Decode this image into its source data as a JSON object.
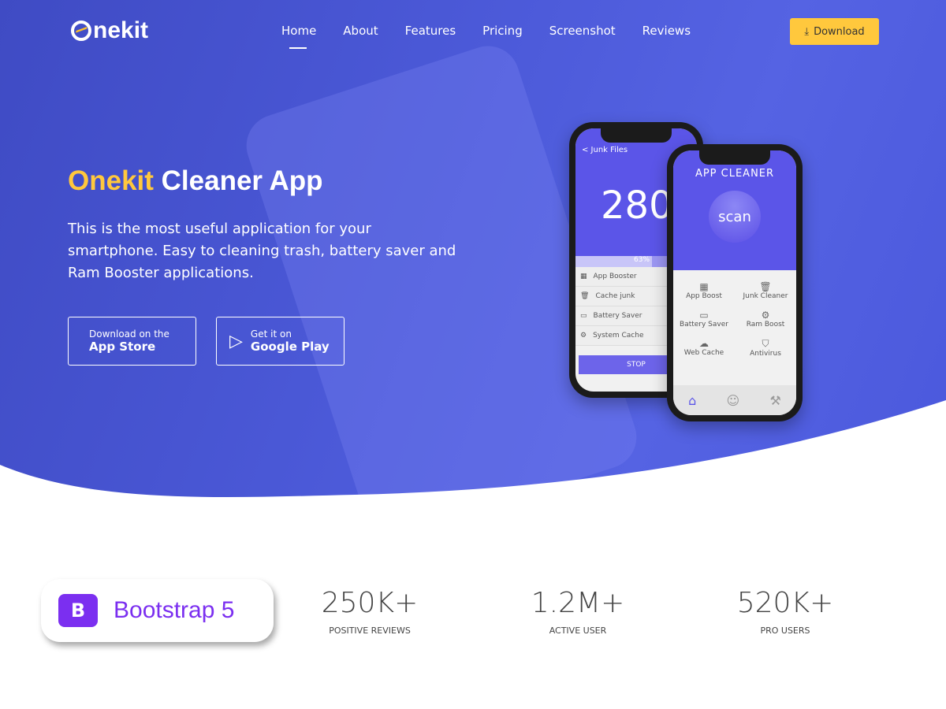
{
  "nav": {
    "logo": "nekit",
    "items": [
      "Home",
      "About",
      "Features",
      "Pricing",
      "Screenshot",
      "Reviews"
    ],
    "active": "Home",
    "download": "Download"
  },
  "hero": {
    "title_highlight": "Onekit",
    "title_rest": " Cleaner App",
    "description": "This is the most useful application for your smartphone. Easy to cleaning trash, battery saver and Ram Booster applications.",
    "appstore": {
      "small": "Download on the",
      "large": "App Store"
    },
    "googleplay": {
      "small": "Get it on",
      "large": "Google Play"
    }
  },
  "phone_back": {
    "header": "< Junk Files",
    "number": "280",
    "progress": "63%",
    "progress_value": 63,
    "items": [
      "App Booster",
      "Cache junk",
      "Battery Saver",
      "System Cache"
    ],
    "button": "STOP"
  },
  "phone_front": {
    "header": "APP CLEANER",
    "scan": "scan",
    "items": [
      "App Boost",
      "Junk Cleaner",
      "Battery Saver",
      "Ram Boost",
      "Web Cache",
      "Antivirus"
    ]
  },
  "badge": {
    "letter": "B",
    "text": "Bootstrap 5"
  },
  "stats": [
    {
      "value": "250K+",
      "label": "POSITIVE REVIEWS"
    },
    {
      "value": "1.2M+",
      "label": "ACTIVE USER"
    },
    {
      "value": "520K+",
      "label": "PRO USERS"
    }
  ],
  "colors": {
    "accent": "#ffc83d",
    "hero": "#4c5ad9",
    "bootstrap": "#7b2ff0"
  }
}
